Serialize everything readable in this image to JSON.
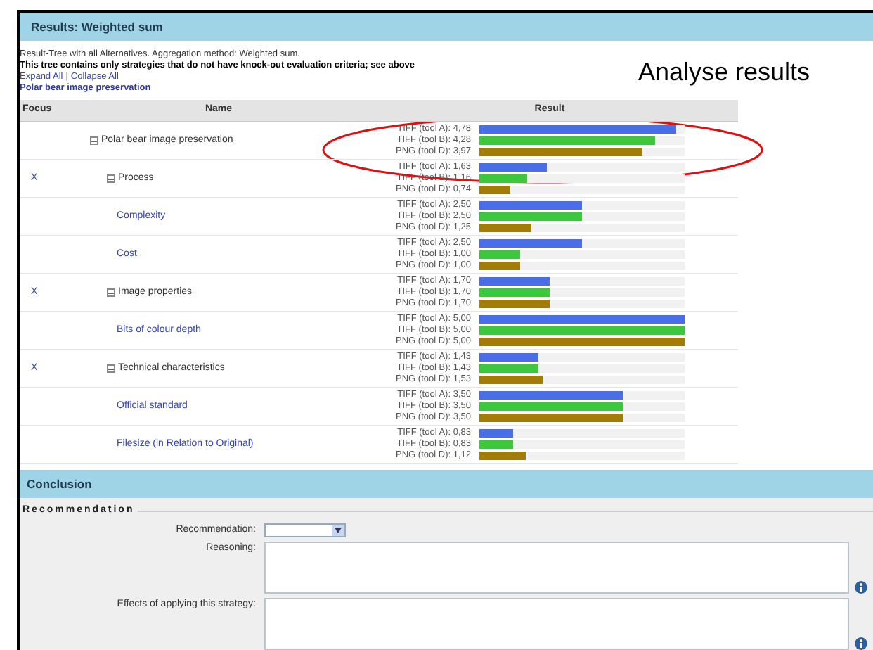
{
  "annotation": {
    "title": "Analyse results"
  },
  "results_panel": {
    "title": "Results: Weighted sum",
    "description": "Result-Tree with all Alternatives. Aggregation method: Weighted sum.",
    "note": "This tree contains only strategies that do not have knock-out evaluation criteria; see above",
    "expand_all": "Expand All",
    "separator": "|",
    "collapse_all": "Collapse All",
    "plan_link": "Polar bear image preservation"
  },
  "table": {
    "columns": [
      "Focus",
      "Name",
      "Result"
    ],
    "rows": [
      {
        "name": "Polar bear image preservation",
        "expanded": true,
        "link": false,
        "results": [
          {
            "label": "TIFF (tool A): 4,78",
            "level": 0.956,
            "color": "#4a6ee8"
          },
          {
            "label": "TIFF (tool B): 4,28",
            "level": 0.856,
            "color": "#3cc83c"
          },
          {
            "label": "PNG (tool D): 3,97",
            "level": 0.794,
            "color": "#a27c08"
          }
        ],
        "children": [
          {
            "focus": "X",
            "name": "Process",
            "expanded": true,
            "link": false,
            "results": [
              {
                "label": "TIFF (tool A): 1,63",
                "level": 0.326,
                "color": "#4a6ee8"
              },
              {
                "label": "TIFF (tool B): 1,16",
                "level": 0.232,
                "color": "#3cc83c"
              },
              {
                "label": "PNG (tool D): 0,74",
                "level": 0.148,
                "color": "#a27c08"
              }
            ],
            "children": [
              {
                "name": "Complexity",
                "link": true,
                "results": [
                  {
                    "label": "TIFF (tool A): 2,50",
                    "level": 0.5,
                    "color": "#4a6ee8"
                  },
                  {
                    "label": "TIFF (tool B): 2,50",
                    "level": 0.5,
                    "color": "#3cc83c"
                  },
                  {
                    "label": "PNG (tool D): 1,25",
                    "level": 0.25,
                    "color": "#a27c08"
                  }
                ]
              },
              {
                "name": "Cost",
                "link": true,
                "results": [
                  {
                    "label": "TIFF (tool A): 2,50",
                    "level": 0.5,
                    "color": "#4a6ee8"
                  },
                  {
                    "label": "TIFF (tool B): 1,00",
                    "level": 0.2,
                    "color": "#3cc83c"
                  },
                  {
                    "label": "PNG (tool D): 1,00",
                    "level": 0.2,
                    "color": "#a27c08"
                  }
                ]
              }
            ]
          },
          {
            "focus": "X",
            "name": "Image properties",
            "expanded": true,
            "link": false,
            "results": [
              {
                "label": "TIFF (tool A): 1,70",
                "level": 0.34,
                "color": "#4a6ee8"
              },
              {
                "label": "TIFF (tool B): 1,70",
                "level": 0.34,
                "color": "#3cc83c"
              },
              {
                "label": "PNG (tool D): 1,70",
                "level": 0.34,
                "color": "#a27c08"
              }
            ],
            "children": [
              {
                "name": "Bits of colour depth",
                "link": true,
                "results": [
                  {
                    "label": "TIFF (tool A): 5,00",
                    "level": 1,
                    "color": "#4a6ee8"
                  },
                  {
                    "label": "TIFF (tool B): 5,00",
                    "level": 1,
                    "color": "#3cc83c"
                  },
                  {
                    "label": "PNG (tool D): 5,00",
                    "level": 1,
                    "color": "#a27c08"
                  }
                ]
              }
            ]
          },
          {
            "focus": "X",
            "name": "Technical characteristics",
            "expanded": true,
            "link": false,
            "results": [
              {
                "label": "TIFF (tool A): 1,43",
                "level": 0.286,
                "color": "#4a6ee8"
              },
              {
                "label": "TIFF (tool B): 1,43",
                "level": 0.286,
                "color": "#3cc83c"
              },
              {
                "label": "PNG (tool D): 1,53",
                "level": 0.306,
                "color": "#a27c08"
              }
            ],
            "children": [
              {
                "name": "Official standard",
                "link": true,
                "results": [
                  {
                    "label": "TIFF (tool A): 3,50",
                    "level": 0.7,
                    "color": "#4a6ee8"
                  },
                  {
                    "label": "TIFF (tool B): 3,50",
                    "level": 0.7,
                    "color": "#3cc83c"
                  },
                  {
                    "label": "PNG (tool D): 3,50",
                    "level": 0.7,
                    "color": "#a27c08"
                  }
                ]
              },
              {
                "name": "Filesize (in Relation to Original)",
                "link": true,
                "results": [
                  {
                    "label": "TIFF (tool A): 0,83",
                    "level": 0.166,
                    "color": "#4a6ee8"
                  },
                  {
                    "label": "TIFF (tool B): 0,83",
                    "level": 0.166,
                    "color": "#3cc83c"
                  },
                  {
                    "label": "PNG (tool D): 1,12",
                    "level": 0.224,
                    "color": "#a27c08"
                  }
                ]
              }
            ]
          }
        ]
      }
    ]
  },
  "conclusion": {
    "title": "Conclusion",
    "section": "Recommendation",
    "fields": [
      {
        "kind": "select",
        "label": "Recommendation:"
      },
      {
        "kind": "textarea",
        "label": "Reasoning:"
      },
      {
        "kind": "textarea",
        "label": "Effects of applying this strategy:"
      }
    ]
  }
}
